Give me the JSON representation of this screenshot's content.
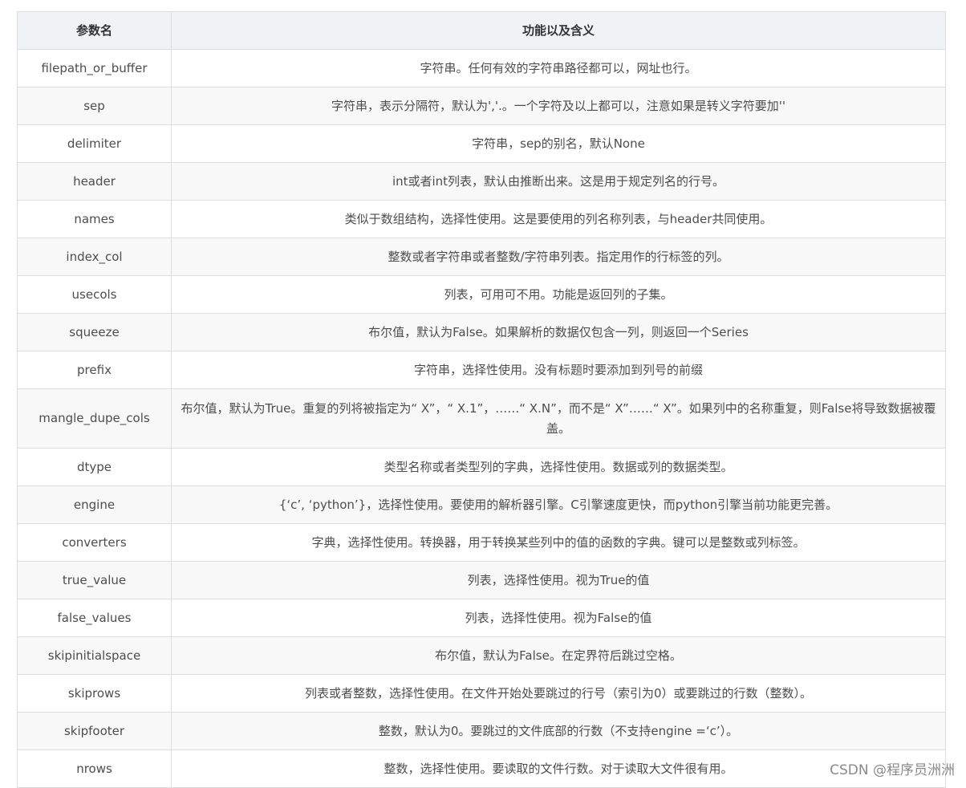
{
  "table": {
    "headers": [
      "参数名",
      "功能以及含义"
    ],
    "rows": [
      [
        "filepath_or_buffer",
        "字符串。任何有效的字符串路径都可以，网址也行。"
      ],
      [
        "sep",
        "字符串，表示分隔符，默认为','.。一个字符及以上都可以，注意如果是转义字符要加''"
      ],
      [
        "delimiter",
        "字符串，sep的别名，默认None"
      ],
      [
        "header",
        "int或者int列表，默认由推断出来。这是用于规定列名的行号。"
      ],
      [
        "names",
        "类似于数组结构，选择性使用。这是要使用的列名称列表，与header共同使用。"
      ],
      [
        "index_col",
        "整数或者字符串或者整数/字符串列表。指定用作的行标签的列。"
      ],
      [
        "usecols",
        "列表，可用可不用。功能是返回列的子集。"
      ],
      [
        "squeeze",
        "布尔值，默认为False。如果解析的数据仅包含一列，则返回一个Series"
      ],
      [
        "prefix",
        "字符串，选择性使用。没有标题时要添加到列号的前缀"
      ],
      [
        "mangle_dupe_cols",
        "布尔值，默认为True。重复的列将被指定为“ X”，“ X.1”，……“ X.N”，而不是“ X”……“ X”。如果列中的名称重复，则False将导致数据被覆盖。"
      ],
      [
        "dtype",
        "类型名称或者类型列的字典，选择性使用。数据或列的数据类型。"
      ],
      [
        "engine",
        "{‘c’, ‘python’}，选择性使用。要使用的解析器引擎。C引擎速度更快，而python引擎当前功能更完善。"
      ],
      [
        "converters",
        "字典，选择性使用。转换器，用于转换某些列中的值的函数的字典。键可以是整数或列标签。"
      ],
      [
        "true_value",
        "列表，选择性使用。视为True的值"
      ],
      [
        "false_values",
        "列表，选择性使用。视为False的值"
      ],
      [
        "skipinitialspace",
        "布尔值，默认为False。在定界符后跳过空格。"
      ],
      [
        "skiprows",
        "列表或者整数，选择性使用。在文件开始处要跳过的行号（索引为0）或要跳过的行数（整数）。"
      ],
      [
        "skipfooter",
        "整数，默认为0。要跳过的文件底部的行数（不支持engine =‘c’）。"
      ],
      [
        "nrows",
        "整数，选择性使用。要读取的文件行数。对于读取大文件很有用。"
      ]
    ]
  },
  "watermark": "CSDN @程序员洲洲"
}
